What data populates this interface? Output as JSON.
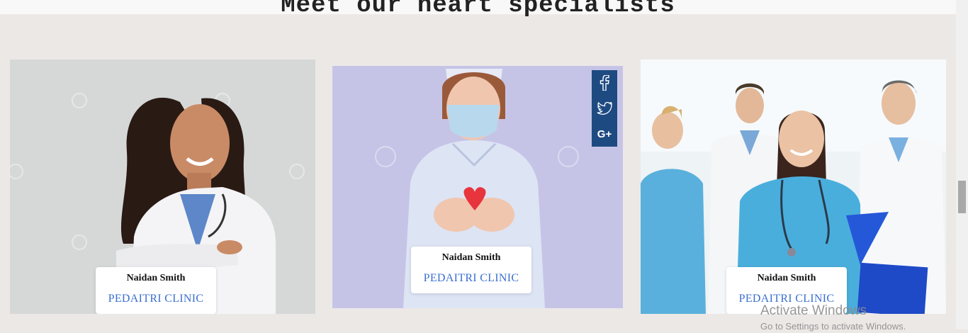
{
  "section": {
    "title": "Meet our heart specialists"
  },
  "doctors": [
    {
      "name": "Naidan Smith",
      "clinic": "PEDAITRI CLINIC",
      "photo_icon": "female-doctor-photo"
    },
    {
      "name": "Naidan Smith",
      "clinic": "PEDAITRI CLINIC",
      "photo_icon": "nurse-with-heart-photo"
    },
    {
      "name": "Naidan Smith",
      "clinic": "PEDAITRI CLINIC",
      "photo_icon": "medical-team-photo"
    }
  ],
  "social": {
    "items": [
      {
        "icon": "facebook-icon"
      },
      {
        "icon": "twitter-icon"
      },
      {
        "icon": "google-plus-icon"
      }
    ],
    "color": "#1e4a82"
  },
  "watermark": {
    "line1": "Activate Windows",
    "line2": "Go to Settings to activate Windows."
  },
  "colors": {
    "background": "#ece8e6",
    "clinic_text": "#3a6fd0"
  }
}
